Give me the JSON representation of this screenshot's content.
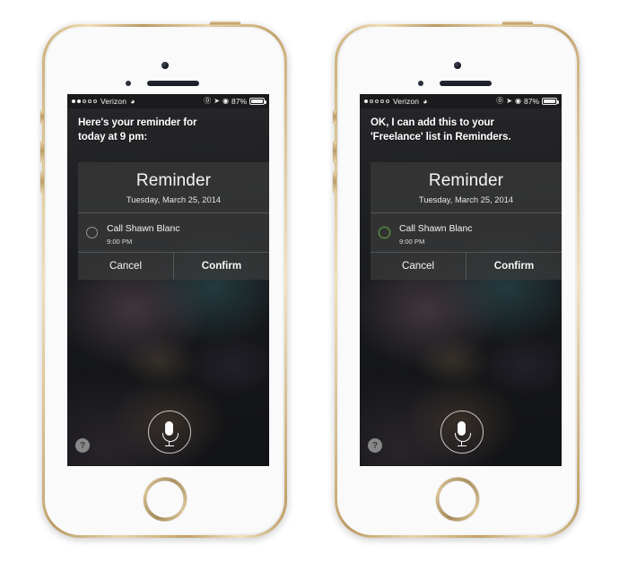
{
  "page": {
    "background_color": "#ffffff",
    "device_count": 2
  },
  "phones": [
    {
      "id": "left",
      "device_name": "iphone-gold-left",
      "status_bar": {
        "signal_dots_filled": 2,
        "signal_dots_total": 5,
        "carrier": "Verizon",
        "wifi_icon": "wifi-icon",
        "alarm_icon": "alarm-clock-icon",
        "location_icon": "location-arrow-icon",
        "rotation_lock_icon": "rotation-lock-icon",
        "battery_percent": "87%",
        "battery_level": 87
      },
      "siri": {
        "reply_line1": "Here's your reminder for",
        "reply_line2": "today at 9 pm:",
        "mic_icon": "microphone-icon",
        "help_label": "?"
      },
      "card": {
        "title": "Reminder",
        "date": "Tuesday, March 25, 2014",
        "task_name": "Call Shawn Blanc",
        "task_time": "9:00 PM",
        "bullet_state": "unchecked-grey",
        "bullet_color": "#9b958c",
        "cancel_label": "Cancel",
        "confirm_label": "Confirm"
      }
    },
    {
      "id": "right",
      "device_name": "iphone-gold-right",
      "status_bar": {
        "signal_dots_filled": 1,
        "signal_dots_total": 5,
        "carrier": "Verizon",
        "wifi_icon": "wifi-icon",
        "alarm_icon": "alarm-clock-icon",
        "location_icon": "location-arrow-icon",
        "rotation_lock_icon": "rotation-lock-icon",
        "battery_percent": "87%",
        "battery_level": 87
      },
      "siri": {
        "reply_line1": "OK, I can add this to your",
        "reply_line2": "'Freelance' list in Reminders.",
        "mic_icon": "microphone-icon",
        "help_label": "?"
      },
      "card": {
        "title": "Reminder",
        "date": "Tuesday, March 25, 2014",
        "task_name": "Call Shawn Blanc",
        "task_time": "9:00 PM",
        "bullet_state": "selected-green",
        "bullet_color": "#5f9e3f",
        "cancel_label": "Cancel",
        "confirm_label": "Confirm"
      }
    }
  ]
}
